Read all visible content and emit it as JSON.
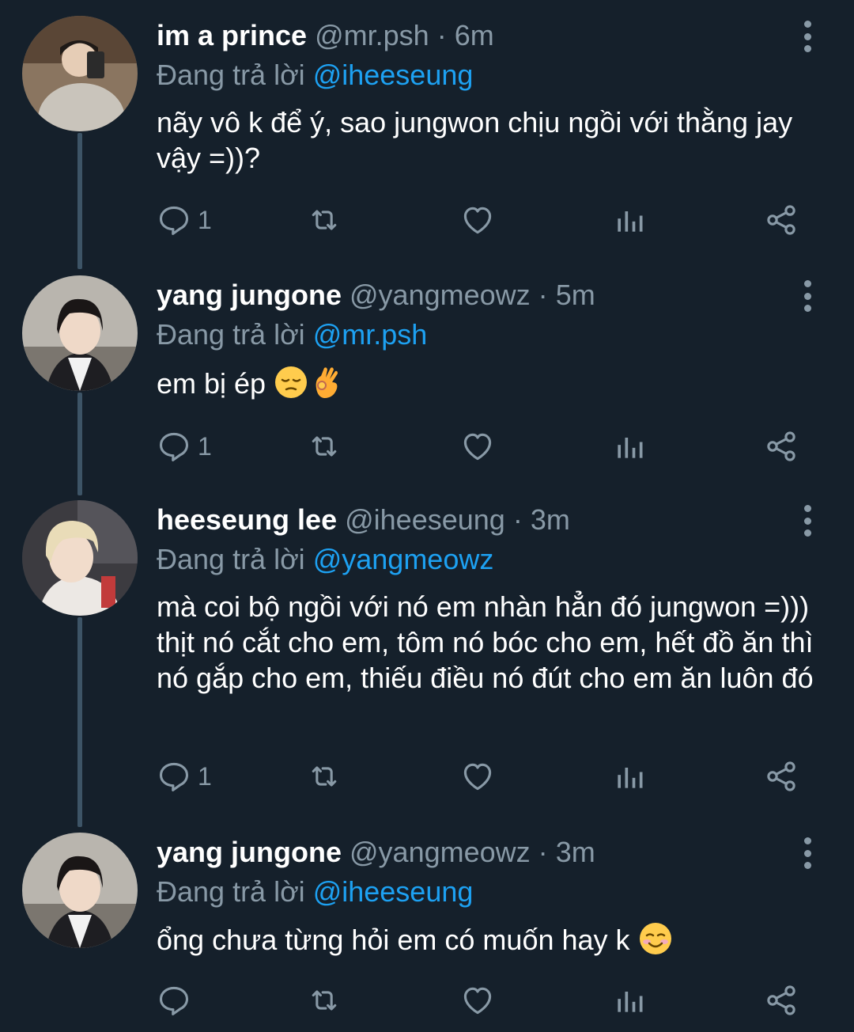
{
  "tweets": [
    {
      "display_name": "im a prince",
      "handle": "@mr.psh",
      "separator": "·",
      "time": "6m",
      "replying_label": "Đang trả lời",
      "replying_to": "@iheeseung",
      "text": "nãy vô k để ý, sao jungwon chịu ngồi với thằng jay vậy =))?",
      "reply_count": "1",
      "avatar_icon": "avatar-photo"
    },
    {
      "display_name": "yang jungone",
      "handle": "@yangmeowz",
      "separator": "·",
      "time": "5m",
      "replying_label": "Đang trả lời",
      "replying_to": "@mr.psh",
      "text": "em bị ép",
      "emojis": [
        "pensive-face-emoji",
        "ok-hand-emoji"
      ],
      "reply_count": "1",
      "avatar_icon": "avatar-photo"
    },
    {
      "display_name": "heeseung lee",
      "handle": "@iheeseung",
      "separator": "·",
      "time": "3m",
      "replying_label": "Đang trả lời",
      "replying_to": "@yangmeowz",
      "text": "mà coi bộ ngồi với nó em nhàn hẳn đó jungwon =))) thịt nó cắt cho em, tôm nó bóc cho em, hết đồ ăn thì nó gắp cho em, thiếu điều nó đút cho em ăn luôn đó",
      "reply_count": "1",
      "avatar_icon": "avatar-photo"
    },
    {
      "display_name": "yang jungone",
      "handle": "@yangmeowz",
      "separator": "·",
      "time": "3m",
      "replying_label": "Đang trả lời",
      "replying_to": "@iheeseung",
      "text": "ổng chưa từng hỏi em có muốn hay k",
      "emojis": [
        "smiling-face-emoji"
      ],
      "reply_count": "",
      "avatar_icon": "avatar-photo"
    }
  ],
  "colors": {
    "background": "#15202b",
    "primary_text": "#ffffff",
    "secondary_text": "#8899a6",
    "accent": "#1da1f2",
    "thread_line": "#3d5466"
  },
  "action_icons": [
    "reply-icon",
    "retweet-icon",
    "like-icon",
    "analytics-icon",
    "share-icon"
  ]
}
